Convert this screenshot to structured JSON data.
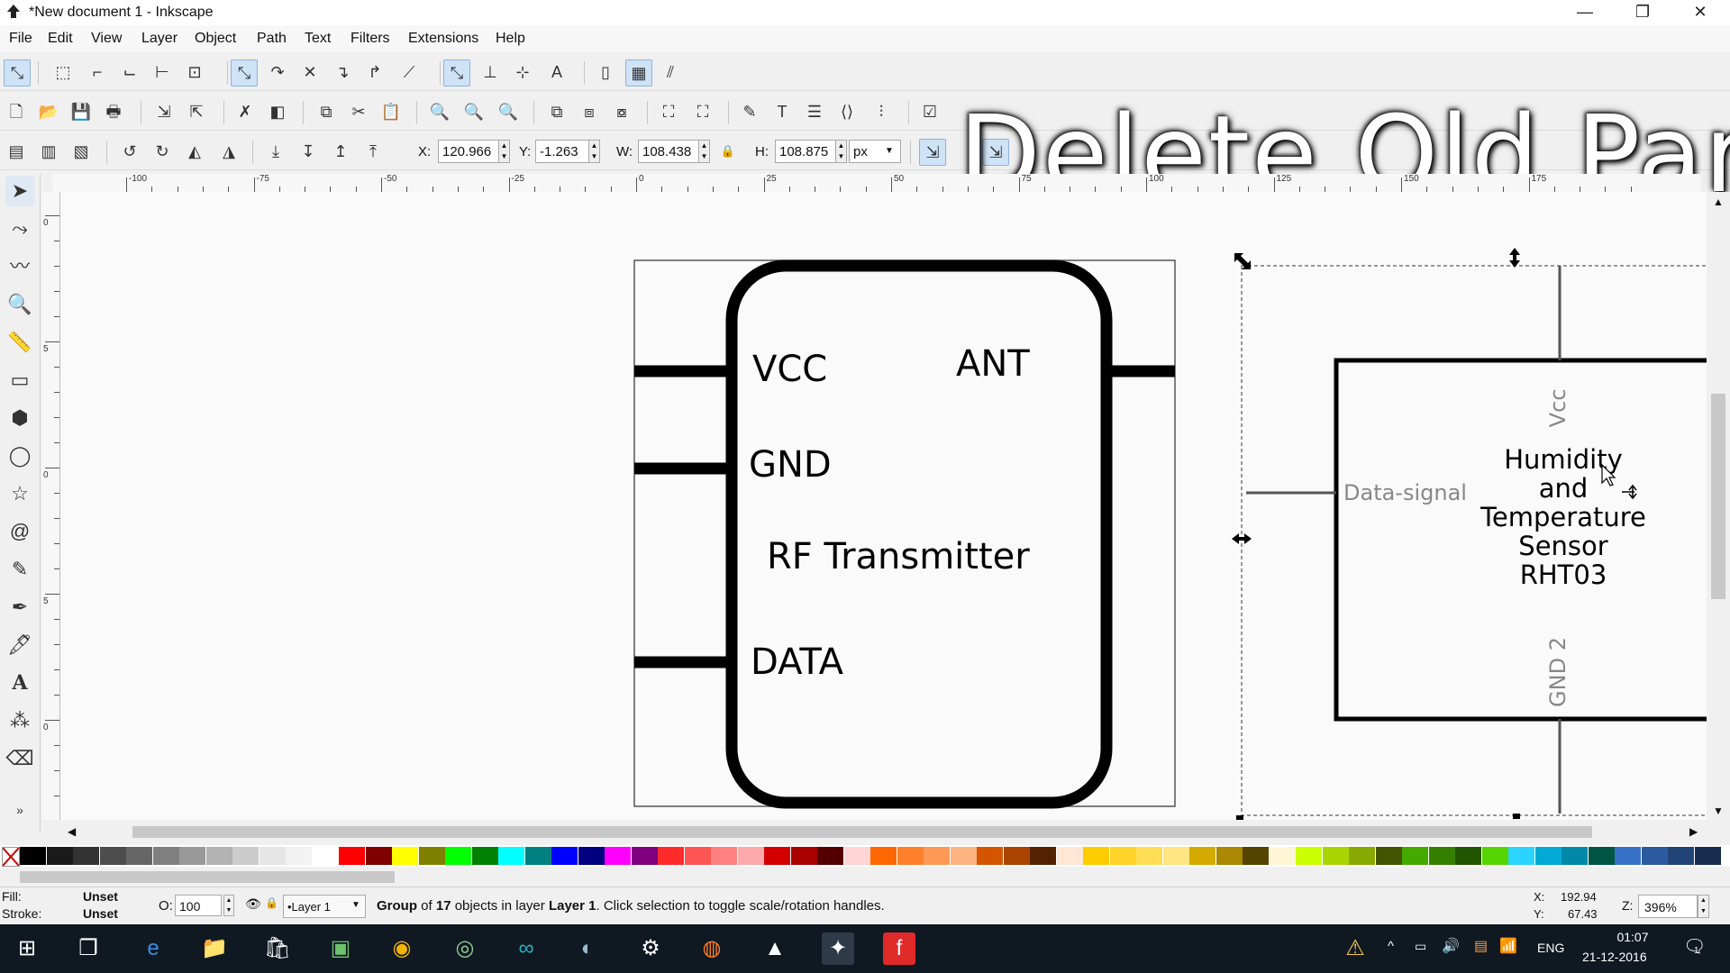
{
  "window": {
    "title": "*New document 1 - Inkscape",
    "minimize": "—",
    "restore": "❐",
    "close": "✕"
  },
  "menu": [
    "File",
    "Edit",
    "View",
    "Layer",
    "Object",
    "Path",
    "Text",
    "Filters",
    "Extensions",
    "Help"
  ],
  "overlay_caption": "Delete Old Part",
  "transform": {
    "x_label": "X:",
    "x_value": "120.966",
    "y_label": "Y:",
    "y_value": "-1.263",
    "w_label": "W:",
    "w_value": "108.438",
    "h_label": "H:",
    "h_value": "108.875",
    "unit": "px"
  },
  "hruler_labels": [
    "-100",
    "-75",
    "-50",
    "-25",
    "0",
    "25",
    "50",
    "75",
    "100",
    "125",
    "150",
    "175"
  ],
  "vruler_labels": [
    "0",
    "5",
    "0",
    "5",
    "0",
    "5"
  ],
  "rf_module": {
    "vcc": "VCC",
    "ant": "ANT",
    "gnd": "GND",
    "name": "RF Transmitter",
    "data": "DATA"
  },
  "sensor": {
    "vcc": "Vcc",
    "data_signal": "Data-signal",
    "line1": "Humidity",
    "line2": "and",
    "line3": "Temperature",
    "line4": "Sensor",
    "line5": "RHT03",
    "gnd": "GND 2"
  },
  "palette_colors": [
    "#000000",
    "#1a1a1a",
    "#333333",
    "#4d4d4d",
    "#666666",
    "#808080",
    "#999999",
    "#b3b3b3",
    "#cccccc",
    "#e6e6e6",
    "#f2f2f2",
    "#ffffff",
    "#ff0000",
    "#800000",
    "#ffff00",
    "#808000",
    "#00ff00",
    "#008000",
    "#00ffff",
    "#008080",
    "#0000ff",
    "#000080",
    "#ff00ff",
    "#800080",
    "#ff2a2a",
    "#ff5555",
    "#ff8080",
    "#ffaaaa",
    "#d40000",
    "#aa0000",
    "#550000",
    "#ffd5d5",
    "#ff6600",
    "#ff7f2a",
    "#ff9955",
    "#ffb380",
    "#d45500",
    "#aa4400",
    "#552200",
    "#ffe6d5",
    "#ffcc00",
    "#ffd42a",
    "#ffdd55",
    "#ffe680",
    "#d4aa00",
    "#aa8800",
    "#554400",
    "#fff6d5",
    "#ccff00",
    "#aad400",
    "#88aa00",
    "#445500",
    "#44aa00",
    "#338000",
    "#225500",
    "#55d400",
    "#2ad4ff",
    "#00aad4",
    "#0088aa",
    "#005544",
    "#3771c8",
    "#2c5aa0",
    "#214478",
    "#162d50"
  ],
  "status": {
    "fill_label": "Fill:",
    "fill_value": "Unset",
    "stroke_label": "Stroke:",
    "stroke_value": "Unset",
    "opacity_label": "O:",
    "opacity_value": "100",
    "layer": "•Layer 1",
    "message_pre": "Group",
    "message_of": " of ",
    "message_count": "17",
    "message_mid": " objects in layer ",
    "message_layer": "Layer 1",
    "message_post": ". Click selection to toggle scale/rotation handles.",
    "cursor_x_label": "X:",
    "cursor_x": "192.94",
    "cursor_y_label": "Y:",
    "cursor_y": "67.43",
    "zoom_label": "Z:",
    "zoom": "396%"
  },
  "taskbar": {
    "lang": "ENG",
    "time": "01:07",
    "date": "21-12-2016",
    "notify_count": "1"
  }
}
